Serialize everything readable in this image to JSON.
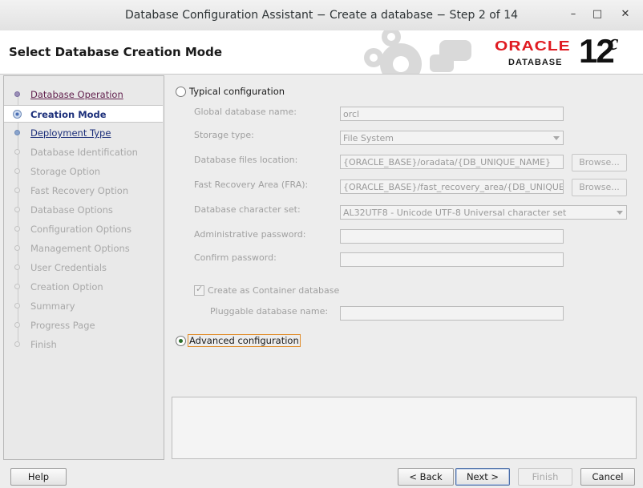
{
  "window": {
    "title": "Database Configuration Assistant − Create a database − Step 2 of 14",
    "controls": {
      "minimize": "–",
      "maximize": "□",
      "close": "✕"
    }
  },
  "banner": {
    "heading": "Select Database Creation Mode",
    "logo_oracle": "ORACLE",
    "logo_database": "DATABASE",
    "logo_version": "12",
    "logo_version_suffix": "c"
  },
  "steps": [
    {
      "label": "Database Operation",
      "state": "done"
    },
    {
      "label": "Creation Mode",
      "state": "current"
    },
    {
      "label": "Deployment Type",
      "state": "next"
    },
    {
      "label": "Database Identification",
      "state": "pending"
    },
    {
      "label": "Storage Option",
      "state": "pending"
    },
    {
      "label": "Fast Recovery Option",
      "state": "pending"
    },
    {
      "label": "Database Options",
      "state": "pending"
    },
    {
      "label": "Configuration Options",
      "state": "pending"
    },
    {
      "label": "Management Options",
      "state": "pending"
    },
    {
      "label": "User Credentials",
      "state": "pending"
    },
    {
      "label": "Creation Option",
      "state": "pending"
    },
    {
      "label": "Summary",
      "state": "pending"
    },
    {
      "label": "Progress Page",
      "state": "pending"
    },
    {
      "label": "Finish",
      "state": "pending"
    }
  ],
  "typical": {
    "label": "Typical configuration",
    "selected": false,
    "global_db_name_label": "Global database name:",
    "global_db_name_value": "orcl",
    "storage_type_label": "Storage type:",
    "storage_type_value": "File System",
    "db_files_location_label": "Database files location:",
    "db_files_location_value": "{ORACLE_BASE}/oradata/{DB_UNIQUE_NAME}",
    "fra_label": "Fast Recovery Area (FRA):",
    "fra_value": "{ORACLE_BASE}/fast_recovery_area/{DB_UNIQUE_NAME}",
    "browse_label": "Browse...",
    "charset_label": "Database character set:",
    "charset_value": "AL32UTF8 - Unicode UTF-8 Universal character set",
    "admin_password_label": "Administrative password:",
    "admin_password_value": "",
    "confirm_password_label": "Confirm password:",
    "confirm_password_value": "",
    "container_label": "Create as Container database",
    "container_checked": true,
    "pluggable_label": "Pluggable database name:",
    "pluggable_value": ""
  },
  "advanced": {
    "label": "Advanced configuration",
    "selected": true
  },
  "buttons": {
    "help": "Help",
    "back": "< Back",
    "next": "Next >",
    "finish": "Finish",
    "cancel": "Cancel"
  },
  "colors": {
    "oracle_red": "#e01b22",
    "step_done": "#63224f",
    "step_link": "#1c2f7a",
    "focus_outline": "#e08d2b"
  }
}
